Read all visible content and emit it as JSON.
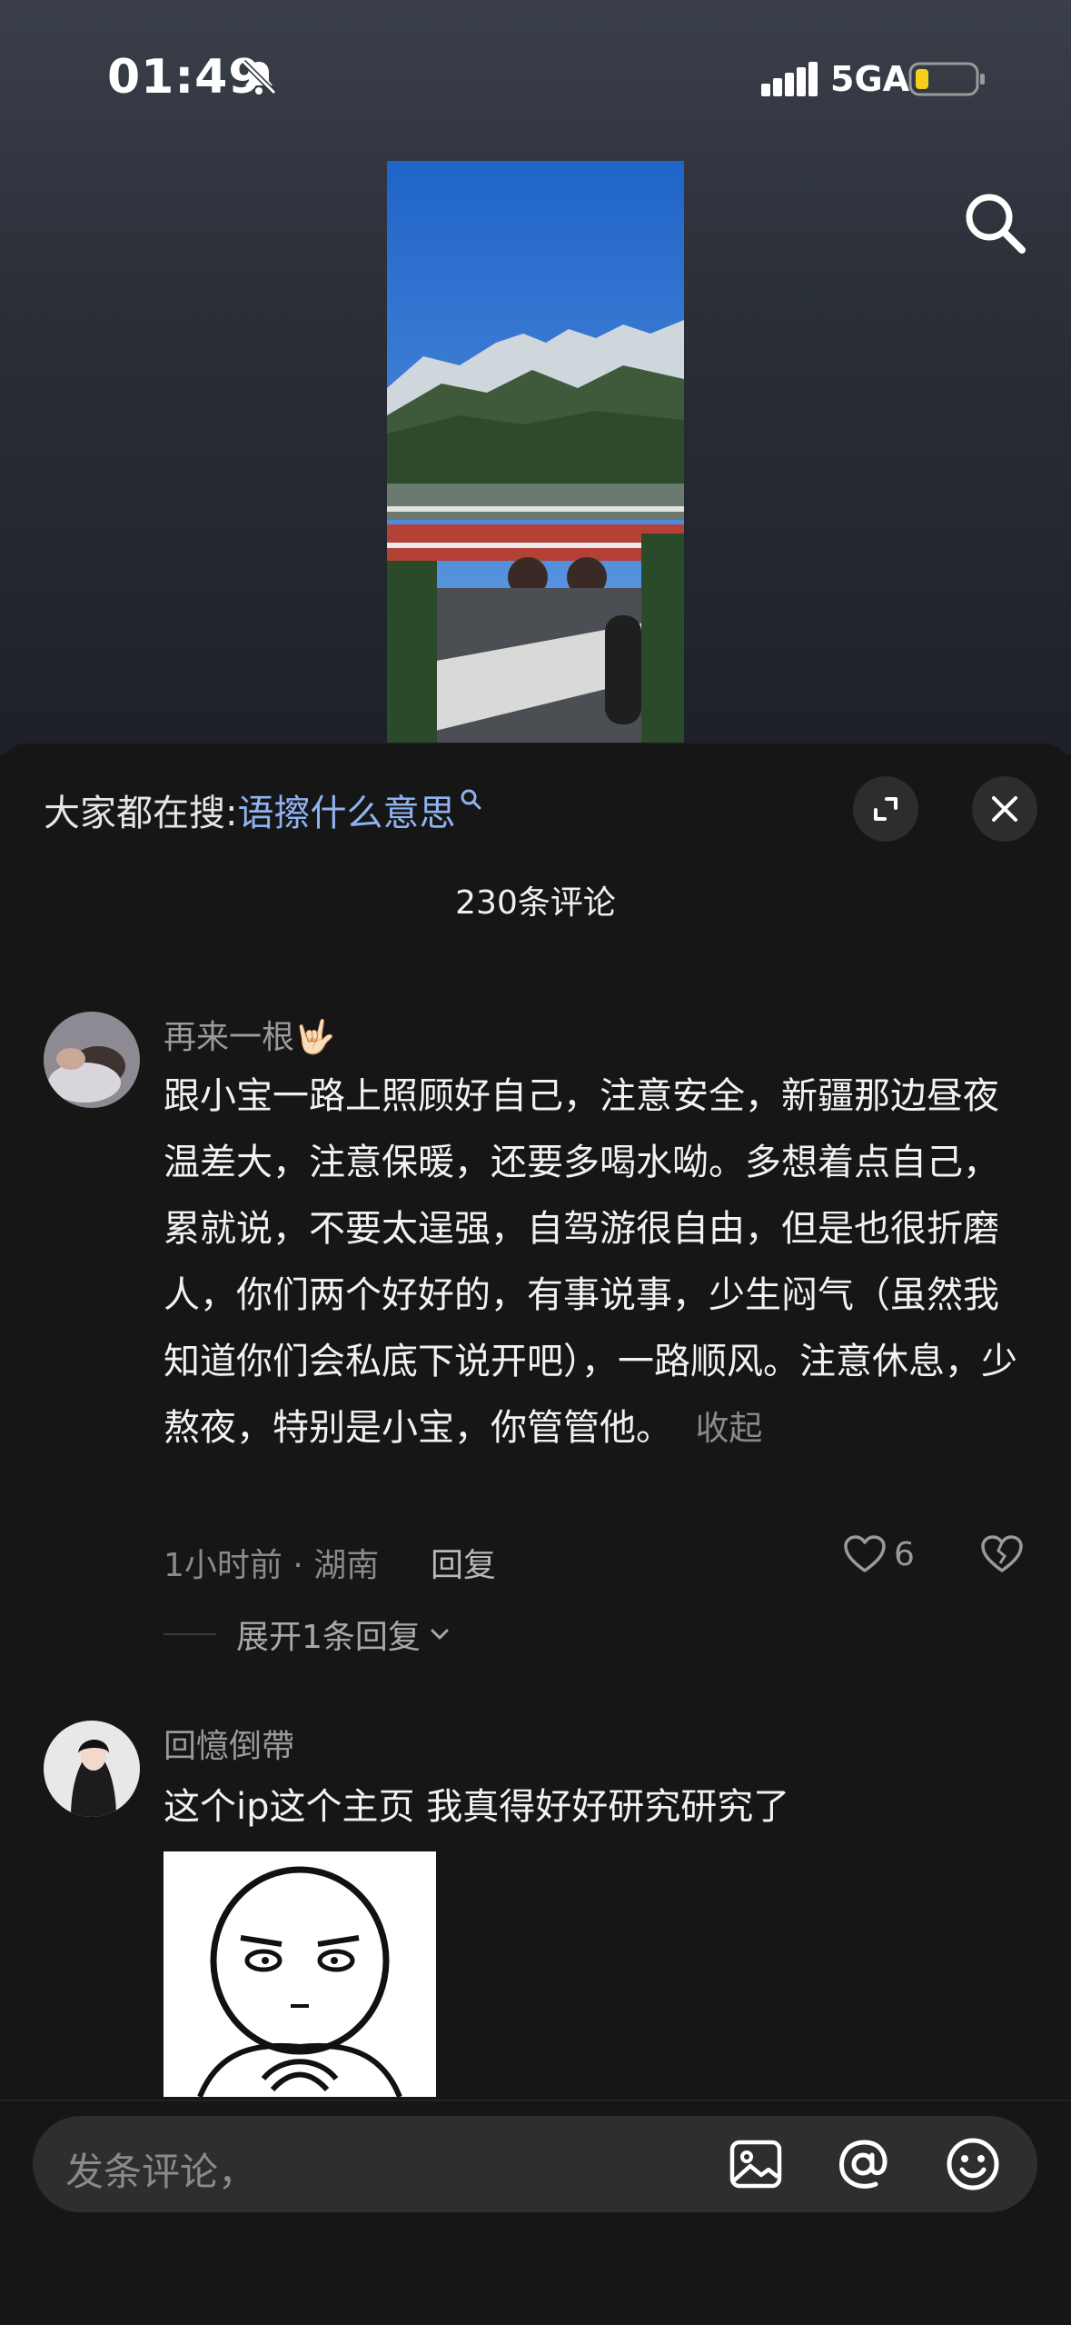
{
  "status": {
    "time": "01:49",
    "network": "5GA",
    "icons": [
      "mute-icon",
      "signal-icon",
      "battery-icon"
    ]
  },
  "header": {
    "search_icon": "search-icon"
  },
  "sheet": {
    "hot_search_prefix": "大家都在搜:",
    "hot_search_term": "语擦什么意思",
    "comment_count": "230条评论"
  },
  "comments": [
    {
      "username": "再来一根🤟🏻",
      "text": "跟小宝一路上照顾好自己，注意安全，新疆那边昼夜温差大，注意保暖，还要多喝水呦。多想着点自己，累就说，不要太逞强，自驾游很自由，但是也很折磨人，你们两个好好的，有事说事，少生闷气（虽然我知道你们会私底下说开吧），一路顺风。注意休息，少熬夜，特别是小宝，你管管他。",
      "collapse_label": "收起",
      "meta": "1小时前 · 湖南",
      "reply_label": "回复",
      "likes": "6",
      "expand_replies": "展开1条回复"
    },
    {
      "username": "回憶倒帶",
      "text": "这个ip这个主页 我真得好好研究研究了"
    }
  ],
  "input": {
    "placeholder": "发条评论，"
  },
  "colors": {
    "background": "#161616",
    "accent_link": "#8fb3f0",
    "muted_text": "#8a8a8a"
  }
}
